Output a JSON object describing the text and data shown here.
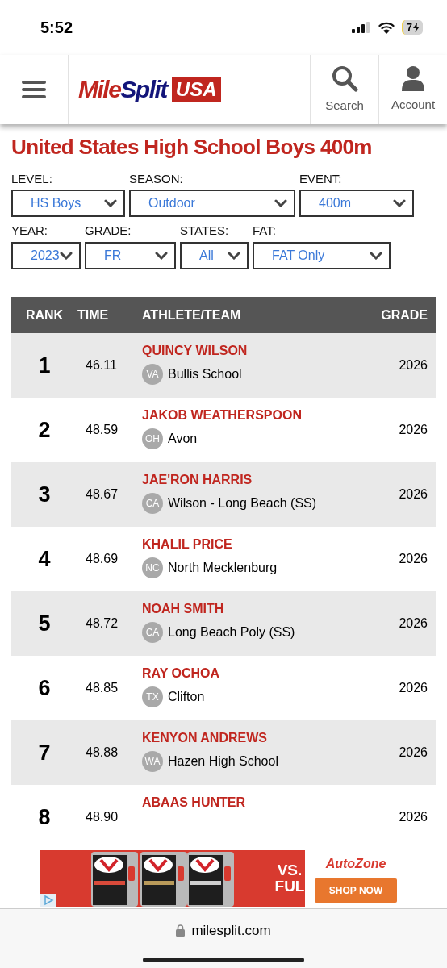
{
  "status_bar": {
    "time": "5:52",
    "battery": "7"
  },
  "header": {
    "logo": {
      "part_1": "Mile",
      "part_2": "Split",
      "badge": "USA"
    },
    "actions": [
      {
        "kind": "search",
        "label": "Search"
      },
      {
        "kind": "account",
        "label": "Account"
      }
    ]
  },
  "title": "United States High School Boys 400m",
  "filter_rows": [
    {
      "filters": [
        {
          "label": "LEVEL:",
          "value": "HS Boys"
        },
        {
          "label": "SEASON:",
          "value": "Outdoor"
        },
        {
          "label": "EVENT:",
          "value": "400m"
        }
      ]
    },
    {
      "filters": [
        {
          "label": "YEAR:",
          "value": "2023"
        },
        {
          "label": "GRADE:",
          "value": "FR"
        },
        {
          "label": "STATES:",
          "value": "All"
        },
        {
          "label": "FAT:",
          "value": "FAT Only"
        }
      ]
    }
  ],
  "table": {
    "columns": [
      "RANK",
      "TIME",
      "ATHLETE/TEAM",
      "GRADE"
    ],
    "rows": [
      {
        "rank": "1",
        "time": "46.11",
        "athlete": "QUINCY WILSON",
        "state": "VA",
        "school": "Bullis School",
        "grade": "2026"
      },
      {
        "rank": "2",
        "time": "48.59",
        "athlete": "JAKOB WEATHERSPOON",
        "state": "OH",
        "school": "Avon",
        "grade": "2026"
      },
      {
        "rank": "3",
        "time": "48.67",
        "athlete": "JAE'RON HARRIS",
        "state": "CA",
        "school": "Wilson - Long Beach (SS)",
        "grade": "2026"
      },
      {
        "rank": "4",
        "time": "48.69",
        "athlete": "KHALIL PRICE",
        "state": "NC",
        "school": "North Mecklenburg",
        "grade": "2026"
      },
      {
        "rank": "5",
        "time": "48.72",
        "athlete": "NOAH SMITH",
        "state": "CA",
        "school": "Long Beach Poly (SS)",
        "grade": "2026"
      },
      {
        "rank": "6",
        "time": "48.85",
        "athlete": "RAY OCHOA",
        "state": "TX",
        "school": "Clifton",
        "grade": "2026"
      },
      {
        "rank": "7",
        "time": "48.88",
        "athlete": "KENYON ANDREWS",
        "state": "WA",
        "school": "Hazen High School",
        "grade": "2026"
      },
      {
        "rank": "8",
        "time": "48.90",
        "athlete": "ABAAS HUNTER",
        "grade": "2026"
      }
    ]
  },
  "ad": {
    "headline_1": "VS.",
    "headline_2": "FUL",
    "brand": "AutoZone",
    "button": "SHOP NOW"
  },
  "browser": {
    "url": "milesplit.com"
  }
}
